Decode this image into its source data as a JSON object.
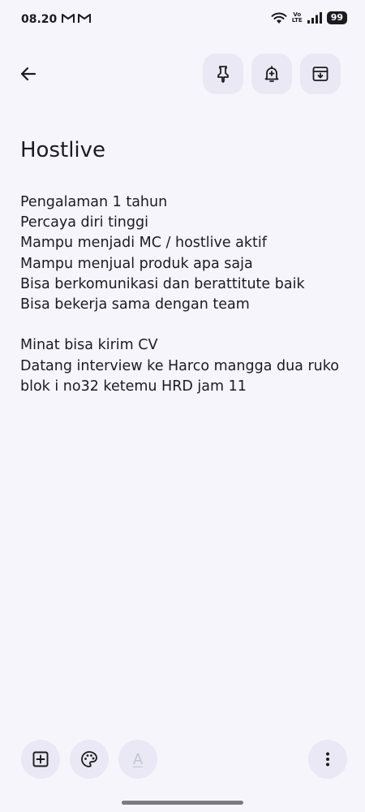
{
  "status_bar": {
    "time": "08.20",
    "notification_icons": [
      "gmail-icon",
      "gmail-icon"
    ],
    "network_label_top": "Vo",
    "network_label_bottom": "LTE",
    "battery": "99"
  },
  "toolbar": {
    "back_icon": "arrow-back-icon",
    "pin_icon": "pin-icon",
    "reminder_icon": "bell-plus-icon",
    "archive_icon": "archive-icon"
  },
  "note": {
    "title": "Hostlive",
    "lines": [
      "Pengalaman 1 tahun",
      "Percaya diri tinggi",
      "Mampu menjadi MC / hostlive aktif",
      "Mampu menjual produk apa saja",
      "Bisa berkomunikasi dan berattitute baik",
      "Bisa bekerja sama dengan team",
      "",
      "Minat bisa kirim CV",
      "Datang interview ke Harco mangga dua ruko blok i no32 ketemu HRD jam 11"
    ]
  },
  "bottom_bar": {
    "add_icon": "add-box-icon",
    "palette_icon": "palette-icon",
    "format_label": "A",
    "more_icon": "more-vert-icon"
  },
  "colors": {
    "background": "#f6f5fc",
    "button_bg": "#e9e8f4",
    "text": "#1c1b1f"
  }
}
